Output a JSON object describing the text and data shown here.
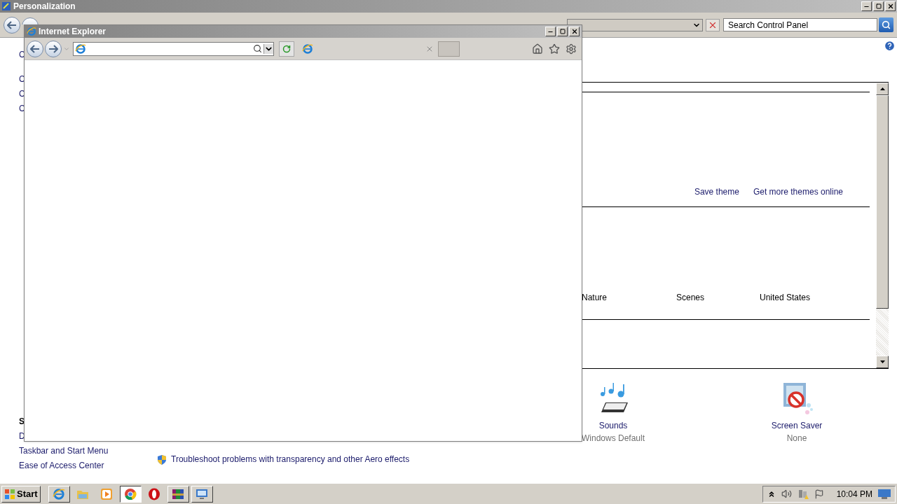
{
  "personalization_window": {
    "title": "Personalization",
    "search": {
      "placeholder": "Search Control Panel"
    },
    "sidebar_fragments": [
      "C",
      "C",
      "C",
      "C"
    ],
    "see_also": {
      "heading": "S",
      "links": [
        "D",
        "Taskbar and Start Menu",
        "Ease of Access Center"
      ]
    },
    "troubleshoot_link": "Troubleshoot problems with transparency and other Aero effects",
    "theme_actions": [
      "Save theme",
      "Get more themes online"
    ],
    "theme_groups": [
      "Nature",
      "Scenes",
      "United States"
    ],
    "settings": [
      {
        "kind": "sounds",
        "label": "Sounds",
        "value": "Windows Default"
      },
      {
        "kind": "screen_saver",
        "label": "Screen Saver",
        "value": "None"
      }
    ]
  },
  "ie_window": {
    "title": "Internet Explorer"
  },
  "taskbar": {
    "start": "Start",
    "apps": [
      {
        "kind": "ie",
        "open": true,
        "selected": false
      },
      {
        "kind": "explorer",
        "open": false,
        "selected": false
      },
      {
        "kind": "media",
        "open": false,
        "selected": false
      },
      {
        "kind": "chrome",
        "open": true,
        "selected": true
      },
      {
        "kind": "opera",
        "open": false,
        "selected": false
      },
      {
        "kind": "winrar",
        "open": true,
        "selected": false
      },
      {
        "kind": "remote",
        "open": true,
        "selected": false
      }
    ],
    "clock": "10:04 PM"
  }
}
